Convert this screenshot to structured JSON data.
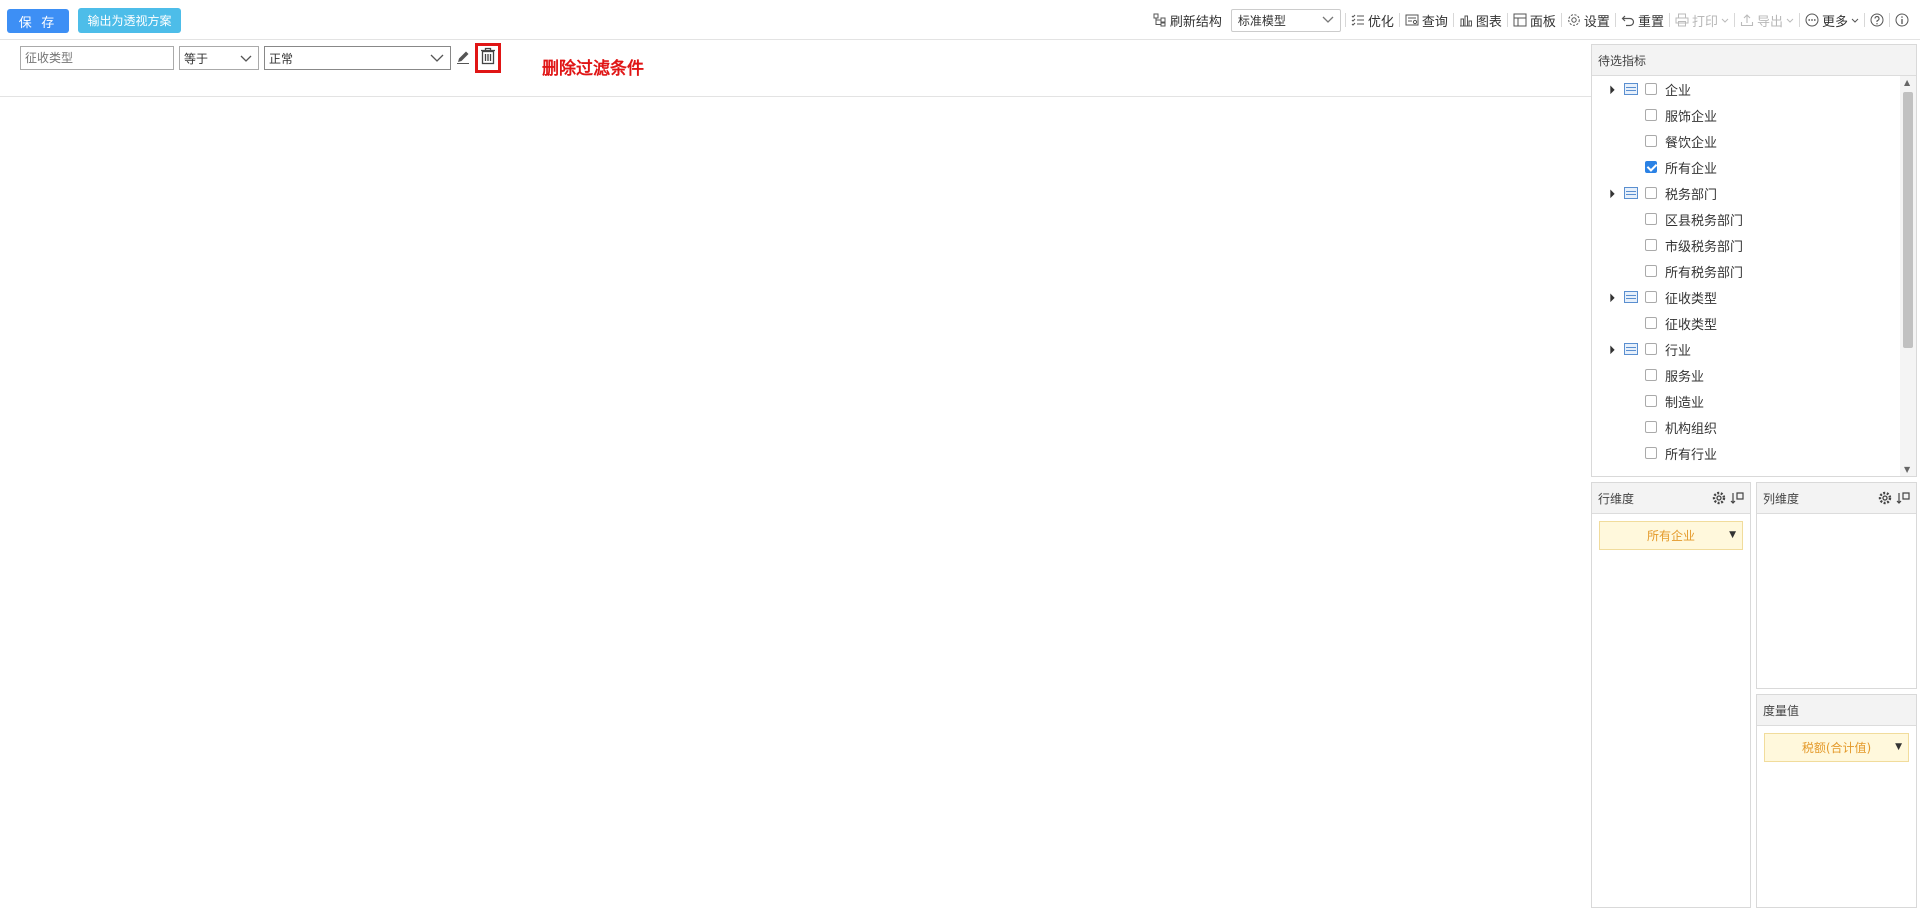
{
  "toolbar": {
    "save_label": "保 存",
    "export_plan_label": "输出为透视方案",
    "refresh_structure": "刷新结构",
    "model_select": "标准模型",
    "optimize": "优化",
    "query": "查询",
    "chart": "图表",
    "panel": "面板",
    "settings": "设置",
    "reset": "重置",
    "print": "打印",
    "export": "导出",
    "more": "更多"
  },
  "filter": {
    "field_placeholder": "征收类型",
    "operator": "等于",
    "value": "正常",
    "annotation": "删除过滤条件"
  },
  "candidates": {
    "title": "待选指标",
    "items": [
      {
        "label": "企业",
        "level": 0,
        "checked": false
      },
      {
        "label": "服饰企业",
        "level": 1,
        "checked": false
      },
      {
        "label": "餐饮企业",
        "level": 1,
        "checked": false
      },
      {
        "label": "所有企业",
        "level": 1,
        "checked": true
      },
      {
        "label": "税务部门",
        "level": 0,
        "checked": false
      },
      {
        "label": "区县税务部门",
        "level": 1,
        "checked": false
      },
      {
        "label": "市级税务部门",
        "level": 1,
        "checked": false
      },
      {
        "label": "所有税务部门",
        "level": 1,
        "checked": false
      },
      {
        "label": "征收类型",
        "level": 0,
        "checked": false
      },
      {
        "label": "征收类型",
        "level": 1,
        "checked": false
      },
      {
        "label": "行业",
        "level": 0,
        "checked": false
      },
      {
        "label": "服务业",
        "level": 1,
        "checked": false
      },
      {
        "label": "制造业",
        "level": 1,
        "checked": false
      },
      {
        "label": "机构组织",
        "level": 1,
        "checked": false
      },
      {
        "label": "所有行业",
        "level": 1,
        "checked": false
      }
    ]
  },
  "row_dim": {
    "title": "行维度",
    "chip": "所有企业"
  },
  "col_dim": {
    "title": "列维度"
  },
  "measure": {
    "title": "度量值",
    "chip": "税额(合计值)"
  },
  "colors": {
    "save": "#3d8ff5",
    "export_plan": "#4dbde9",
    "highlight": "#e01515",
    "chip_text": "#e49a2b"
  }
}
